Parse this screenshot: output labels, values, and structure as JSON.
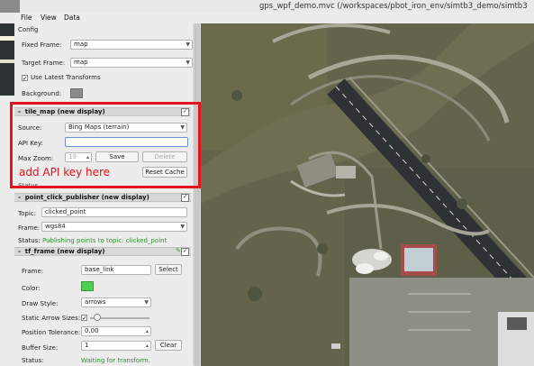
{
  "window": {
    "title": "gps_wpf_demo.mvc (/workspaces/pbot_iron_env/simtb3_demo/simtb3"
  },
  "menubar": {
    "file": "File",
    "view": "View",
    "data": "Data"
  },
  "config": {
    "section_label": "Config",
    "fixed_frame_label": "Fixed Frame:",
    "fixed_frame_value": "map",
    "target_frame_label": "Target Frame:",
    "target_frame_value": "map",
    "use_latest_label": "Use Latest Transforms",
    "use_latest_checked": "✓",
    "background_label": "Background:",
    "background_color": "#8a8a8a"
  },
  "tile_map": {
    "header": "tile_map (new display)",
    "collapse_glyph": "-",
    "enabled_glyph": "✓",
    "source_label": "Source:",
    "source_value": "Bing Maps (terrain)",
    "api_key_label": "API Key:",
    "api_key_value": "",
    "max_zoom_label": "Max Zoom:",
    "max_zoom_value": "19",
    "save_label": "Save",
    "delete_label": "Delete",
    "reset_cache_label": "Reset Cache",
    "status_partial": "Status"
  },
  "annotation": {
    "text": "add API key here",
    "color": "#e4141e"
  },
  "point_click": {
    "header": "point_click_publisher (new display)",
    "collapse_glyph": "-",
    "enabled_glyph": "✓",
    "topic_label": "Topic:",
    "topic_value": "clicked_point",
    "frame_label": "Frame:",
    "frame_value": "wgs84",
    "status_label": "Status:",
    "status_value": "Publishing points to topic: clicked_point"
  },
  "tf_frame": {
    "header": "tf_frame (new display)",
    "collapse_glyph": "-",
    "enabled_glyph": "✓",
    "frame_label": "Frame:",
    "frame_value": "base_link",
    "select_label": "Select",
    "color_label": "Color:",
    "color_value": "#50d050",
    "draw_style_label": "Draw Style:",
    "draw_style_value": "arrows",
    "static_arrow_label": "Static Arrow Sizes:",
    "static_arrow_checked": "✓",
    "static_arrow_slider_fraction": 0.06,
    "position_tol_label": "Position Tolerance:",
    "position_tol_value": "0.00",
    "buffer_size_label": "Buffer Size:",
    "buffer_size_value": "1",
    "clear_label": "Clear",
    "status_label": "Status:",
    "status_value": "Waiting for transform."
  }
}
